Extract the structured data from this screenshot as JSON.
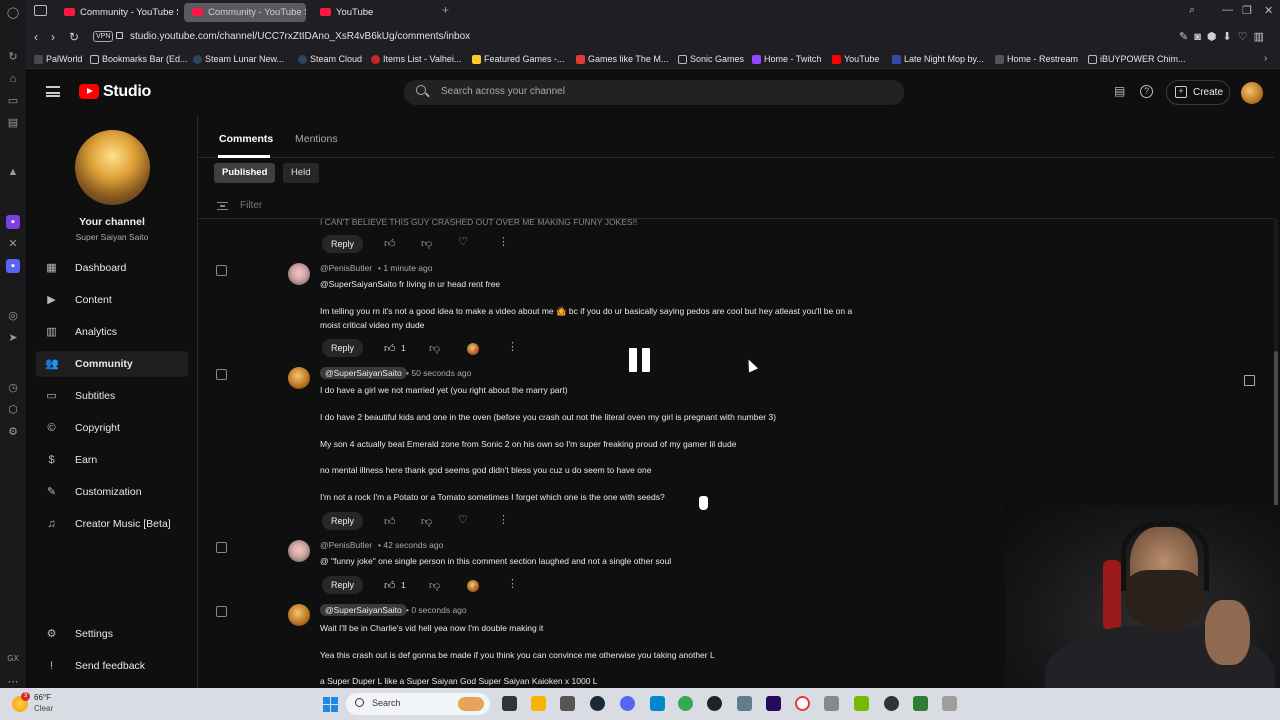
{
  "browser": {
    "tabs": [
      {
        "label": "Community - YouTube St",
        "active": false
      },
      {
        "label": "Community - YouTube St",
        "active": true
      },
      {
        "label": "YouTube",
        "active": false
      }
    ],
    "url": "studio.youtube.com/channel/UCC7rxZtIDAno_XsR4vB6kUg/comments/inbox",
    "vpn_label": "VPN",
    "bookmarks": [
      "PalWorld",
      "Bookmarks Bar (Ed...",
      "Steam Lunar New...",
      "Steam Cloud",
      "Items List - Valhei...",
      "Featured Games -...",
      "Games like The M...",
      "Sonic Games",
      "Home - Twitch",
      "YouTube",
      "Late Night Mop by...",
      "Home - Restream",
      "iBUYPOWER Chim..."
    ]
  },
  "header": {
    "logo_text": "Studio",
    "search_placeholder": "Search across your channel",
    "create_label": "Create"
  },
  "sidebar": {
    "channel_title": "Your channel",
    "channel_name": "Super Saiyan Saito",
    "items": [
      {
        "label": "Dashboard",
        "icon": "dashboard-icon",
        "active": false
      },
      {
        "label": "Content",
        "icon": "content-icon",
        "active": false
      },
      {
        "label": "Analytics",
        "icon": "analytics-icon",
        "active": false
      },
      {
        "label": "Community",
        "icon": "community-icon",
        "active": true
      },
      {
        "label": "Subtitles",
        "icon": "subtitles-icon",
        "active": false
      },
      {
        "label": "Copyright",
        "icon": "copyright-icon",
        "active": false
      },
      {
        "label": "Earn",
        "icon": "earn-icon",
        "active": false
      },
      {
        "label": "Customization",
        "icon": "customization-icon",
        "active": false
      },
      {
        "label": "Creator Music [Beta]",
        "icon": "music-icon",
        "active": false
      }
    ],
    "settings_label": "Settings",
    "feedback_label": "Send feedback"
  },
  "main": {
    "tabs": [
      {
        "label": "Comments",
        "active": true
      },
      {
        "label": "Mentions",
        "active": false
      }
    ],
    "chips": [
      {
        "label": "Published",
        "active": true
      },
      {
        "label": "Held",
        "active": false
      }
    ],
    "filter_placeholder": "Filter",
    "cut_text": "I CAN'T BELIEVE THIS GUY CRASHED OUT OVER ME MAKING FUNNY JOKES!!",
    "reply_label": "Reply",
    "comments": [
      {
        "author": "@PenisButler",
        "time": "1 minute ago",
        "lines": [
          "@SuperSaiyanSaito fr living in ur head rent free",
          "",
          "Im telling you rn it's not a good idea to make a video about me 🤷 bc if you do ur basically saying pedos are cool but hey atleast you'll be on a",
          "moist critical video my dude"
        ],
        "likes": "1"
      },
      {
        "author": "@SuperSaiyanSaito",
        "time": "50 seconds ago",
        "lines": [
          "I do have a girl we not married yet (you right about the marry part)",
          "I do have 2 beautiful kids and one in the oven (before you crash out not the literal oven my girl is pregnant with number 3)",
          "My son 4 actually beat Emerald zone from Sonic 2 on his own so I'm super freaking proud of my gamer lil dude",
          "no mental illness here thank god seems god didn't bless you cuz u do seem to have one",
          "I'm not a rock I'm a Potato or a Tomato sometimes I forget which one is the one with seeds?"
        ]
      },
      {
        "author": "@PenisButler",
        "time": "42 seconds ago",
        "lines": [
          "@ \"funny joke\" one single person in this comment section laughed and not a single other soul"
        ],
        "likes": "1"
      },
      {
        "author": "@SuperSaiyanSaito",
        "time": "0 seconds ago",
        "lines": [
          "Wait I'll be in Charlie's vid hell yea now I'm double making it",
          "Yea this crash out is def gonna be made if you think you can convince me otherwise you taking another L",
          "a Super Duper L like a Super Saiyan God Super Saiyan Kaioken x 1000 L"
        ]
      }
    ]
  },
  "taskbar": {
    "temp": "66°F",
    "condition": "Clear",
    "notif": "3",
    "search_label": "Search"
  }
}
